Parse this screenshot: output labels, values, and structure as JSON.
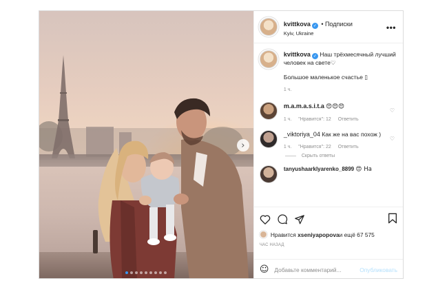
{
  "header": {
    "username": "kvittkova",
    "follow": "• Подписки",
    "location": "Kyiv, Ukraine",
    "more_icon": "ellipsis-icon"
  },
  "caption": {
    "username": "kvittkova",
    "text": "Наш трёхмесячный лучший человек на свете♡",
    "text2": "Большое маленькое счастье ▯",
    "time": "1 ч."
  },
  "comments": [
    {
      "username": "m.a.m.a.s.i.t.a",
      "text": "😍😍😍",
      "time": "1 ч.",
      "likes": "\"Нравится\": 12",
      "reply": "Ответить"
    },
    {
      "username": "_viktoriya_04",
      "text": "Как же на вас похож )",
      "time": "1 ч.",
      "likes": "\"Нравится\": 22",
      "reply": "Ответить",
      "replies": "Скрыть ответы"
    },
    {
      "username": "tanyushaarklyarenko_8899",
      "text": "😍 На"
    }
  ],
  "actions": {
    "likes_prefix": "Нравится ",
    "likes_user": "xseniyapopova",
    "likes_suffix": " и ещё 67 575",
    "time_ago": "час назад"
  },
  "add_comment": {
    "placeholder": "Добавьте комментарий...",
    "publish": "Опубликовать"
  },
  "photo": {
    "slides": 9,
    "active_slide": 1,
    "next_icon": "chevron-right-icon"
  },
  "colors": {
    "accent": "#3897f0",
    "muted": "#8e8e8e",
    "text": "#262626",
    "publish_disabled": "#b2dffc"
  }
}
